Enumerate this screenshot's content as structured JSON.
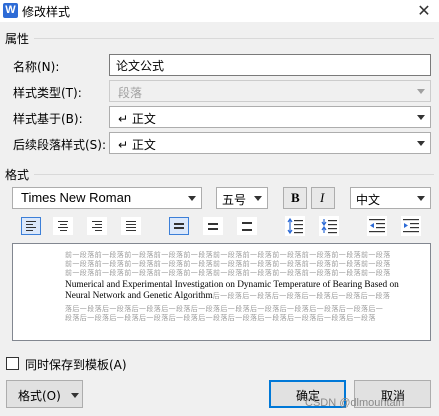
{
  "window": {
    "title": "修改样式",
    "app_icon_text": "W"
  },
  "properties": {
    "section_label": "属性",
    "name_label": "名称(N):",
    "name_value": "论文公式",
    "type_label": "样式类型(T):",
    "type_value": "段落",
    "based_on_label": "样式基于(B):",
    "based_on_value": "↵ 正文",
    "next_label": "后续段落样式(S):",
    "next_value": "↵ 正文"
  },
  "format": {
    "section_label": "格式",
    "font": "Times New Roman",
    "size": "五号",
    "bold_label": "B",
    "italic_label": "I",
    "language": "中文"
  },
  "preview": {
    "prev_lines": [
      "前一段落前一段落前一段落前一段落前一段落前一段落前一段落前一段落前一段落前一段落前一段落",
      "前一段落前一段落前一段落前一段落前一段落前一段落前一段落前一段落前一段落前一段落前一段落",
      "前一段落前一段落前一段落前一段落前一段落前一段落前一段落前一段落前一段落前一段落前一段落"
    ],
    "main_lines": [
      "Numerical and Experimental Investigation on Dynamic Temperature of Bearing Based on",
      "Neural Network and Genetic Algorithm"
    ],
    "main_line2_tail": "后一段落后一段落后一段落后一段落后一段落后一段落",
    "next_lines": [
      "落后一段落后一段落后一段落后一段落后一段落后一段落后一段落后一段落后一段落后一段落后一",
      "段落后一段落后一段落后一段落后一段落后一段落后一段落后一段落后一段落后一段落后一段落"
    ]
  },
  "save_to_template_label": "同时保存到模板(A)",
  "buttons": {
    "format": "格式(O)",
    "ok": "确定",
    "cancel": "取消"
  },
  "watermark": "CSDN @dlmountain"
}
